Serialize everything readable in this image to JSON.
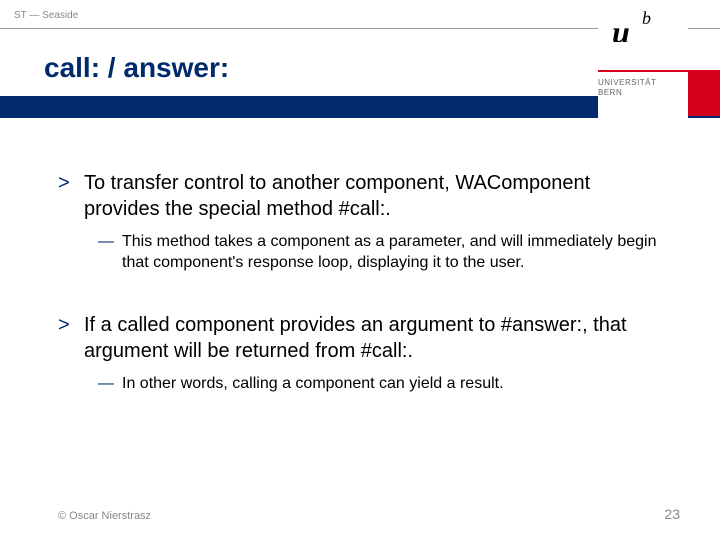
{
  "header": {
    "course_tag": "ST — Seaside"
  },
  "title": "call: / answer:",
  "logo": {
    "u": "u",
    "b": "b",
    "uni_line1": "UNIVERSITÄT",
    "uni_line2": "BERN"
  },
  "bullets": {
    "b1": {
      "mark": ">",
      "text": "To transfer control to another component, WAComponent provides the special method #call:."
    },
    "b1s": {
      "mark": "—",
      "text": "This method takes a component as a parameter, and will immediately begin that component's response loop, displaying it to the user."
    },
    "b2": {
      "mark": ">",
      "text": "If a called component provides an argument to #answer:, that argument will be returned from #call:."
    },
    "b2s": {
      "mark": "—",
      "text": "In other words, calling a component can yield a result."
    }
  },
  "footer": {
    "copyright": "© Oscar Nierstrasz",
    "page": "23"
  }
}
